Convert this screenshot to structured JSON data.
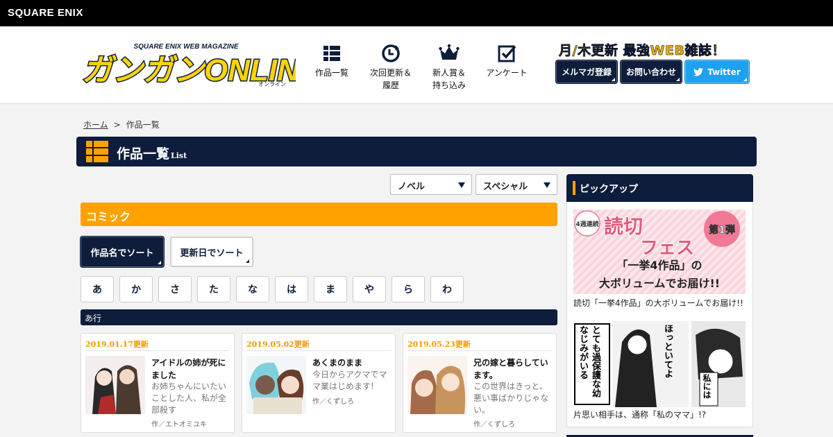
{
  "topbar": {
    "corp": "SQUARE ENIX"
  },
  "header": {
    "logo_text": "ガンガンONLINE",
    "logo_sub": "SQUARE ENIX WEB MAGAZINE",
    "logo_kana": "オンライン",
    "nav": [
      {
        "label": "作品一覧",
        "icon": "list-grid-icon"
      },
      {
        "label": "次回更新＆\n履歴",
        "icon": "clock-refresh-icon"
      },
      {
        "label": "新人賞＆\n持ち込み",
        "icon": "crown-icon"
      },
      {
        "label": "アンケート",
        "icon": "checkbox-icon"
      }
    ],
    "tagline": "月/木更新 最強WEB雑誌！",
    "buttons": {
      "mailmag": "メルマガ登録",
      "contact": "お問い合わせ",
      "twitter": "Twitter"
    }
  },
  "breadcrumb": {
    "home": "ホーム",
    "sep": ">",
    "current": "作品一覧"
  },
  "title": {
    "main": "作品一覧",
    "sub": "List"
  },
  "filters": {
    "novel": "ノベル",
    "special": "スペシャル"
  },
  "section": "コミック",
  "sort": {
    "by_name": "作品名でソート",
    "by_date": "更新日でソート"
  },
  "kana": [
    "あ",
    "か",
    "さ",
    "た",
    "な",
    "は",
    "ま",
    "や",
    "ら",
    "わ"
  ],
  "row_label": "あ行",
  "cards": [
    {
      "date": "2019.01.17更新",
      "title": "アイドルの姉が死にました",
      "desc": "お姉ちゃんにいたいことした人、私が全部殺す",
      "author": "作／エトオミユキ"
    },
    {
      "date": "2019.05.02更新",
      "title": "あくまのまま",
      "desc": "今日からアクマでママ業はじめます!",
      "author": "作／くずしろ"
    },
    {
      "date": "2019.05.23更新",
      "title": "兄の嫁と暮らしています。",
      "desc": "この世界はきっと、悪い事ばかりじゃない。",
      "author": "作／くずしろ"
    }
  ],
  "pickup": {
    "heading": "ピックアップ",
    "banner1": {
      "badge": "4週連続",
      "title1": "読切",
      "title2": "フェス",
      "vol": "第1弾",
      "line1": "「一挙4作品」の",
      "line2": "大ボリュームでお届け!!",
      "caption": "読切「一挙4作品」の大ボリュームでお届け!!"
    },
    "banner2": {
      "text1": "とても過保護な幼なじみがいる",
      "text2": "ほっといてよ",
      "text3": "私には",
      "caption": "片思い相手は、通称「私のママ」!?"
    }
  },
  "colors": {
    "navy": "#0d1d3b",
    "orange": "#ffa200",
    "twitter": "#1da1f2"
  }
}
